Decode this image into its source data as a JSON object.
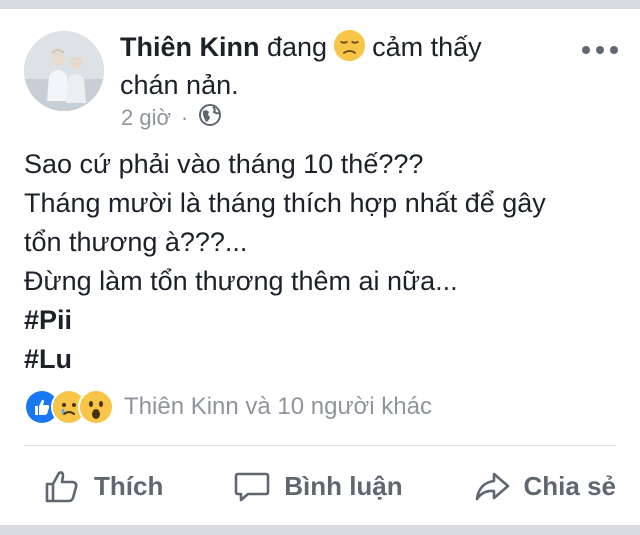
{
  "post": {
    "author": "Thiên Kinn",
    "feeling_prefix": "đang",
    "feeling_emoji": "sad-face",
    "feeling_text": "cảm thấy chán nản.",
    "time": "2 giờ",
    "separator": "·",
    "privacy_icon": "globe-icon",
    "body_lines": [
      "Sao cứ phải vào tháng 10 thế???",
      "Tháng mười là tháng thích hợp nhất để gây",
      "tổn thương à???...",
      "Đừng làm tổn thương thêm ai nữa..."
    ],
    "hashtags": [
      "#Pii",
      "#Lu"
    ]
  },
  "reactions": {
    "icons": [
      "like-reaction",
      "sad-reaction",
      "wow-reaction"
    ],
    "summary": "Thiên Kinn và 10 người khác"
  },
  "actions": {
    "like": "Thích",
    "comment": "Bình luận",
    "share": "Chia sẻ"
  },
  "colors": {
    "text": "#1d2129",
    "muted": "#90949c",
    "action": "#606770",
    "like_blue": "#1877f2",
    "emoji_yellow": "#f7c649",
    "border": "#d9dbe0"
  }
}
